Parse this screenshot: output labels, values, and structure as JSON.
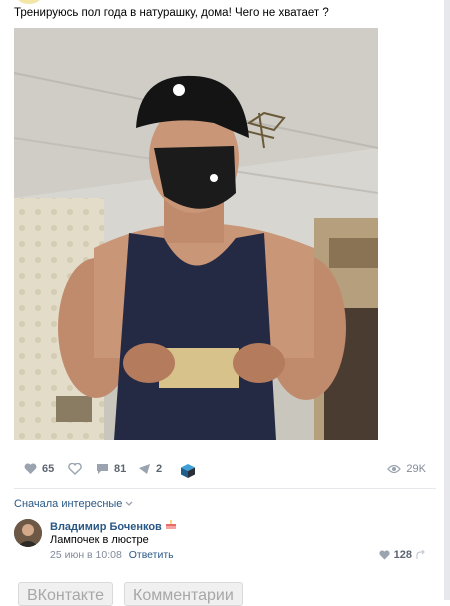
{
  "post": {
    "text": "Тренируюсь пол года в натурашку, дома! Чего не хватает ?"
  },
  "actions": {
    "likes": "65",
    "comments": "81",
    "shares": "2",
    "views": "29K"
  },
  "comments": {
    "sort_label": "Сначала интересные",
    "item": {
      "author": "Владимир Боченков",
      "text": "Лампочек в люстре",
      "date": "25 июн в 10:08",
      "reply_label": "Ответить",
      "likes": "128"
    }
  },
  "footer": {
    "btn1": "ВКонтакте",
    "btn2": "Комментарии"
  },
  "colors": {
    "link": "#2a5885",
    "muted": "#828a99"
  }
}
